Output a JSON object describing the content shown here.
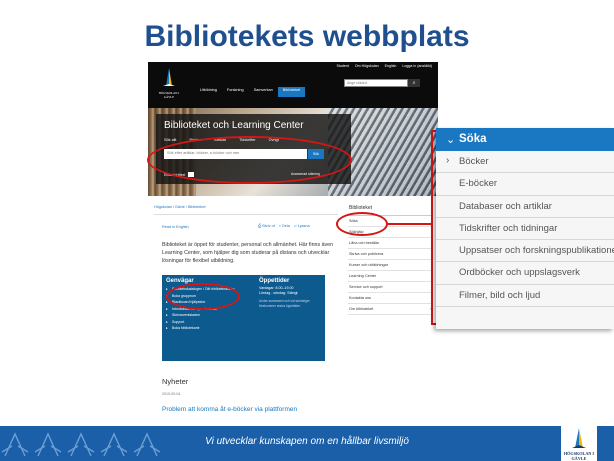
{
  "slide": {
    "title": "Bibliotekets webbplats",
    "footer_text": "Vi utvecklar kunskapen om en hållbar livsmiljö",
    "footer_logo": "HÖGSKOLAN I GÄVLE"
  },
  "website": {
    "logo_text": "HÖGSKOLAN I GÄVLE",
    "top_links": [
      "Student",
      "Om Högskolan",
      "English",
      "Logga in (anställd)"
    ],
    "nav_links": [
      "Utbildning",
      "Forskning",
      "Samverkan",
      "Biblioteket"
    ],
    "active_nav": "Biblioteket",
    "search_placeholder": "Ange sökord",
    "hero": {
      "title": "Biblioteket och Learning Center",
      "tabs": [
        "Sök allt",
        "Böcker",
        "Artiklar",
        "Tidskrifter",
        "Övrigt"
      ],
      "input_placeholder": "Sök efter artiklar, böcker, e-böcker och mer",
      "search_button": "Sök",
      "fulltext_label": "Endast fulltext",
      "advanced_label": "Avancerad sökning"
    },
    "breadcrumb": "Högskolan i Gävle / Biblioteket",
    "read_in_english": "Read in English",
    "tools": [
      "Skriv ut",
      "Dela",
      "Lyssna"
    ],
    "intro_text": "Biblioteket är öppet för studenter, personal och allmänhet. Här finns även Learning Center, som hjälper dig som studerar på distans och utvecklar lösningar för flexibel utbildning.",
    "services": {
      "shortcuts_heading": "Genvägar",
      "shortcuts": [
        "Bibliotekskatalogen / Ditt bibliotekskonto",
        "Boka grupprum",
        "Blackboard hjälpsidor",
        "Introduktion för nya studenter",
        "Skrivarverkstaden",
        "Support",
        "Boka bibliotekarie"
      ],
      "hours_heading": "Öppettider",
      "hours": [
        "Vardagar: 8.00–19.00",
        "Lördag - söndag: Stängt"
      ],
      "hours_note": "Under sommaren och vid storhelger förekommer andra öppettider."
    },
    "news": {
      "heading": "Nyheter",
      "date": "2019-09-04",
      "headline": "Problem att komma åt e-böcker via plattformen"
    },
    "sidebar": {
      "heading": "Biblioteket",
      "items": [
        "Söka",
        "Sökhjälp",
        "Låna och beställa",
        "Skriva och publicera",
        "Kurser och utbildningar",
        "Learning Center",
        "Service och support",
        "Kontakta oss",
        "Om biblioteket"
      ]
    }
  },
  "menu": {
    "header": "Söka",
    "items": [
      "Böcker",
      "E-böcker",
      "Databaser och artiklar",
      "Tidskrifter och tidningar",
      "Uppsatser och forskningspublikationer",
      "Ordböcker och uppslagsverk",
      "Filmer, bild och ljud"
    ]
  },
  "colors": {
    "title_blue": "#1f4f8f",
    "accent_blue": "#1a78c2",
    "services_blue": "#0d5a8e",
    "annotation_red": "#d41616",
    "footer_blue": "#1b5fa8"
  }
}
